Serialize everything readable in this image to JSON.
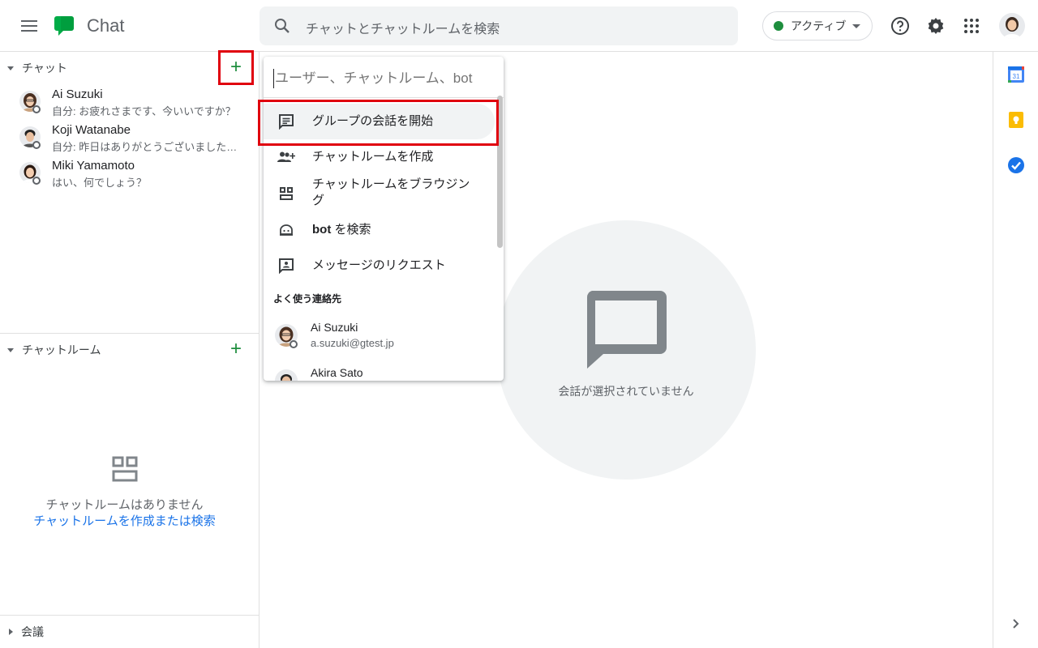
{
  "header": {
    "app_title": "Chat",
    "search_placeholder": "チャットとチャットルームを検索",
    "status_label": "アクティブ",
    "colors": {
      "active": "#1e8e3e",
      "brand_green": "#00ac47"
    }
  },
  "sidebar": {
    "chat_section_label": "チャット",
    "dms": [
      {
        "name": "Ai Suzuki",
        "preview": "自分: お疲れさまです、今いいですか？"
      },
      {
        "name": "Koji Watanabe",
        "preview": "自分: 昨日はありがとうございました…"
      },
      {
        "name": "Miki Yamamoto",
        "preview": "はい、何でしょう？"
      }
    ],
    "rooms_section_label": "チャットルーム",
    "rooms_empty_text": "チャットルームはありません",
    "rooms_empty_link": "チャットルームを作成または検索",
    "meetings_section_label": "会議"
  },
  "main": {
    "no_conversation_text": "会話が選択されていません"
  },
  "popup": {
    "input_placeholder": "ユーザー、チャットルーム、bot",
    "items": [
      {
        "label": "グループの会話を開始",
        "icon": "message-icon"
      },
      {
        "label": "チャットルームを作成",
        "icon": "group-add-icon"
      },
      {
        "label": "チャットルームをブラウジング",
        "icon": "room-browse-icon"
      },
      {
        "label_bold": "bot",
        "label_rest": " を検索",
        "icon": "bot-icon"
      },
      {
        "label": "メッセージのリクエスト",
        "icon": "message-request-icon"
      }
    ],
    "frequent_header": "よく使う連絡先",
    "contacts": [
      {
        "name": "Ai Suzuki",
        "email": "a.suzuki@gtest.jp"
      },
      {
        "name": "Akira Sato",
        "email": ""
      }
    ]
  },
  "rail": {
    "calendar_day": "31"
  }
}
